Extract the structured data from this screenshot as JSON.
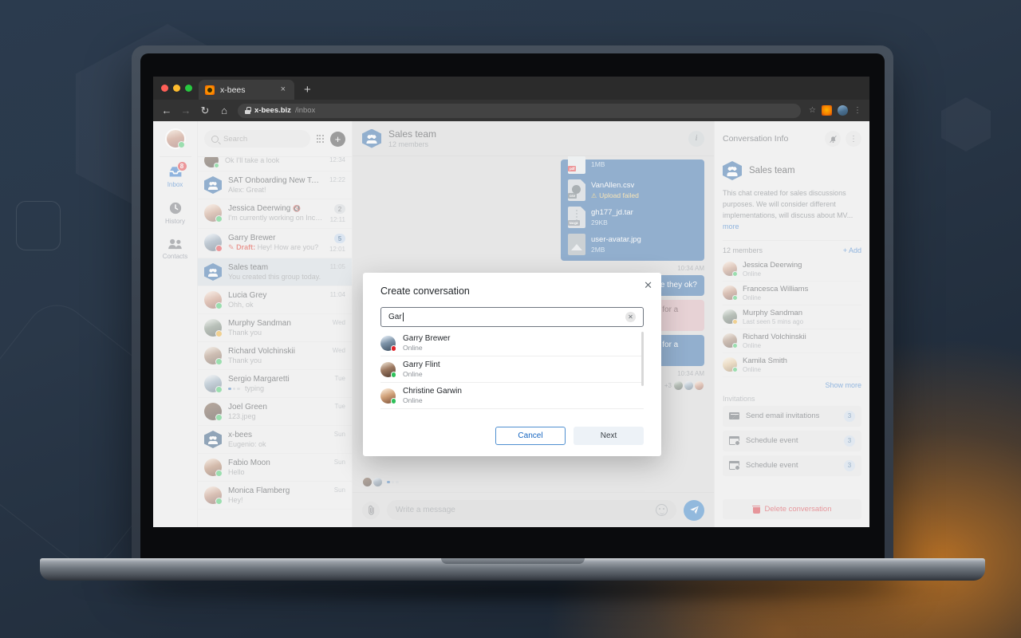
{
  "browser": {
    "tab_title": "x-bees",
    "url_domain": "x-bees.biz",
    "url_path": "/inbox",
    "new_tab_label": "+",
    "close_tab_label": "×",
    "back_icon": "←",
    "forward_icon": "→",
    "reload_icon": "↻",
    "home_icon": "⌂",
    "star_icon": "☆",
    "menu_icon": "⋮"
  },
  "rail": {
    "items": [
      {
        "label": "Inbox",
        "badge": "8",
        "active": true
      },
      {
        "label": "History",
        "badge": "",
        "active": false
      },
      {
        "label": "Contacts",
        "badge": "",
        "active": false
      }
    ]
  },
  "search": {
    "placeholder": "Search",
    "value": ""
  },
  "conversations": [
    {
      "name": "",
      "preview": "Ok I'll take a look",
      "time": "12:34",
      "badge": "",
      "presence": "online",
      "type": "person",
      "partial": true
    },
    {
      "name": "SAT Onboarding New Team",
      "preview": "Alex: Great!",
      "time": "12:22",
      "badge": "",
      "presence": "",
      "type": "group"
    },
    {
      "name": "Jessica Deerwing",
      "preview": "I'm currently working on Incoming mes...",
      "time": "12:11",
      "badge": "2",
      "badge_style": "grey",
      "presence": "online",
      "type": "person",
      "muted": true
    },
    {
      "name": "Garry Brewer",
      "preview": "Hey! How are you?",
      "draft_label": "Draft:",
      "time": "12:01",
      "badge": "5",
      "badge_style": "blue",
      "presence": "busy",
      "type": "person"
    },
    {
      "name": "Sales team",
      "preview": "You created this group today.",
      "time": "11:05",
      "badge": "",
      "presence": "",
      "type": "group",
      "active": true
    },
    {
      "name": "Lucia Grey",
      "preview": "Ohh, ok",
      "time": "11:04",
      "badge": "",
      "presence": "online",
      "type": "person"
    },
    {
      "name": "Murphy Sandman",
      "preview": "Thank you",
      "time": "Wed",
      "badge": "",
      "presence": "away",
      "type": "person"
    },
    {
      "name": "Richard Volchinskii",
      "preview": "Thank you",
      "time": "Wed",
      "badge": "",
      "presence": "online",
      "type": "person"
    },
    {
      "name": "Sergio Margaretti",
      "preview": "typing",
      "time": "Tue",
      "badge": "",
      "presence": "online",
      "type": "person",
      "typing": true
    },
    {
      "name": "Joel Green",
      "preview": "123.jpeg",
      "time": "Tue",
      "badge": "",
      "presence": "online",
      "type": "person"
    },
    {
      "name": "x-bees",
      "preview": "Eugenio: ok",
      "time": "Sun",
      "badge": "",
      "presence": "",
      "type": "group"
    },
    {
      "name": "Fabio Moon",
      "preview": "Hello",
      "time": "Sun",
      "badge": "",
      "presence": "online",
      "type": "person"
    },
    {
      "name": "Monica Flamberg",
      "preview": "Hey!",
      "time": "Sun",
      "badge": "",
      "presence": "online",
      "type": "person"
    }
  ],
  "chat": {
    "title": "Sales team",
    "subtitle": "12 members",
    "info_icon": "i",
    "files": [
      {
        "name": "",
        "meta": "1MB",
        "kind": "pdf"
      },
      {
        "name": "VanAllen.csv",
        "meta": "Upload failed",
        "kind": "csv",
        "error": true
      },
      {
        "name": "gh177_jd.tar",
        "meta": "29KB",
        "kind": "targz"
      },
      {
        "name": "user-avatar.jpg",
        "meta": "2MB",
        "kind": "img"
      }
    ],
    "messages": [
      {
        "text": "e they  ok?",
        "side": "right",
        "style": "out",
        "time": "10:34 AM"
      },
      {
        "text": "He said they are great! Thank you for a help.",
        "side": "right",
        "style": "err",
        "status": "error"
      },
      {
        "text": "He said they are great! Thank you for a help.",
        "side": "right",
        "style": "out",
        "status": "sending",
        "time": "10:34 AM"
      }
    ],
    "read_receipt_count": "+3",
    "composer_placeholder": "Write a message",
    "attach_icon": "📎",
    "send_icon": "send-icon"
  },
  "info": {
    "title": "Conversation Info",
    "bell_icon": "bell-off-icon",
    "menu_icon": "⋮",
    "group_name": "Sales team",
    "description": "This chat created for sales discussions purposes. We will consider different implementations, will discuss about MV...",
    "more_label": "more",
    "members_count": "12 members",
    "add_label": "+ Add",
    "members": [
      {
        "name": "Jessica Deerwing",
        "status": "Online",
        "presence": "online"
      },
      {
        "name": "Francesca Williams",
        "status": "Online",
        "presence": "online"
      },
      {
        "name": "Murphy Sandman",
        "status": "Last seen 5 mins ago",
        "presence": "away"
      },
      {
        "name": "Richard Volchinskii",
        "status": "Online",
        "presence": "online"
      },
      {
        "name": "Kamila Smith",
        "status": "Online",
        "presence": "online"
      }
    ],
    "show_more_label": "Show more",
    "invitations_label": "Invitations",
    "invitations": [
      {
        "label": "Send email invitations",
        "count": "3",
        "icon": "mail-icon"
      },
      {
        "label": "Schedule event",
        "count": "3",
        "icon": "calendar-icon"
      },
      {
        "label": "Schedule event",
        "count": "3",
        "icon": "calendar-icon"
      }
    ],
    "delete_label": "Delete conversation"
  },
  "modal": {
    "title": "Create conversation",
    "close_icon": "✕",
    "input_value": "Gar",
    "clear_icon": "✕",
    "results": [
      {
        "name": "Garry Brewer",
        "status": "Online",
        "presence": "busy"
      },
      {
        "name": "Garry Flint",
        "status": "Online",
        "presence": "online"
      },
      {
        "name": "Christine Garwin",
        "status": "Online",
        "presence": "online"
      }
    ],
    "cancel_label": "Cancel",
    "next_label": "Next"
  },
  "colors": {
    "accent_blue": "#1a5a9e",
    "link_blue": "#1565c0",
    "danger_red": "#d3212b",
    "online_green": "#2ec05a",
    "away_amber": "#e8a317"
  }
}
